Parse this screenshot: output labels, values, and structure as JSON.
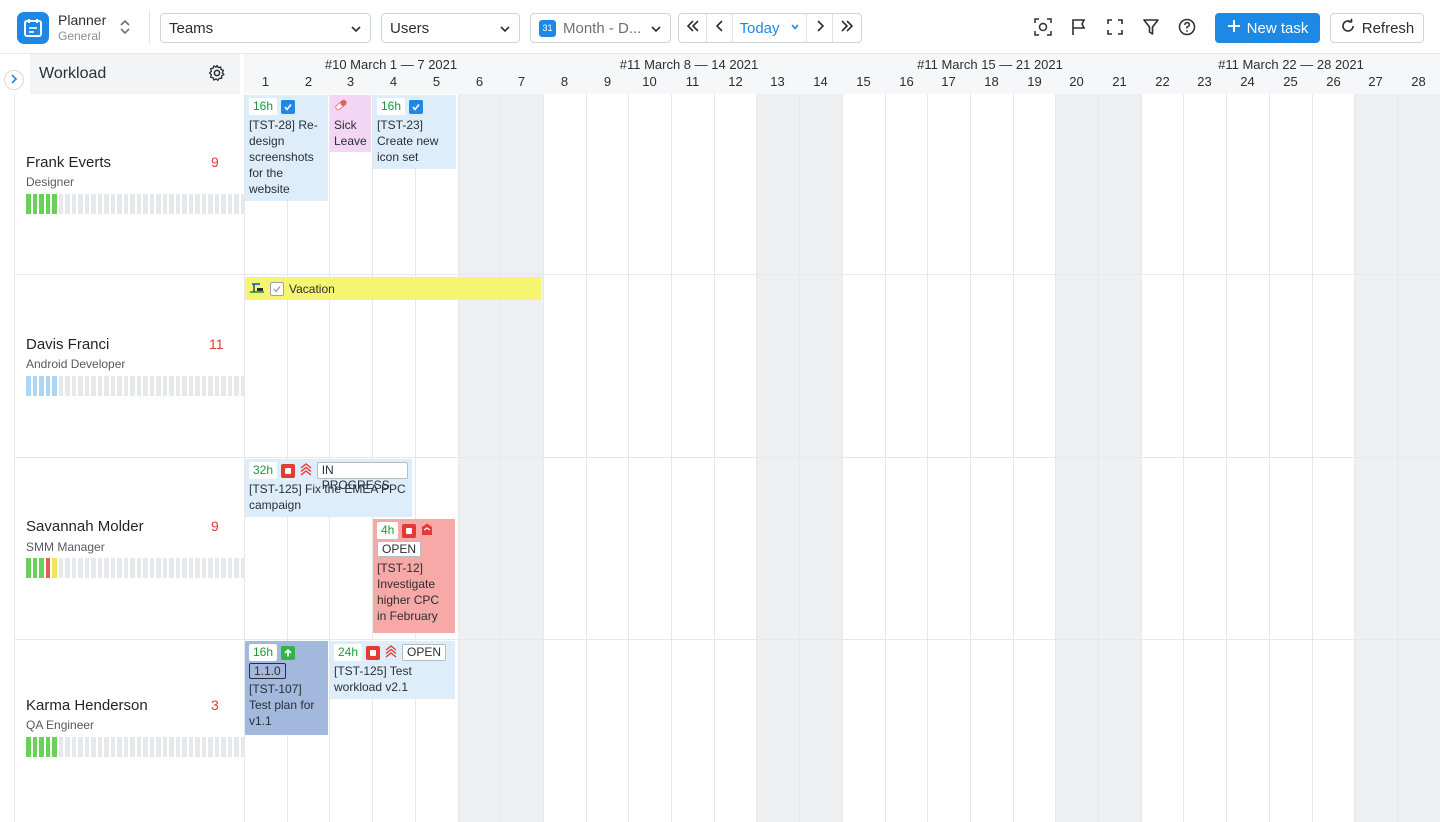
{
  "app": {
    "title": "Planner",
    "subtitle": "General"
  },
  "toolbar": {
    "teams_label": "Teams",
    "users_label": "Users",
    "view_label": "Month - D...",
    "calendar_day": "31",
    "today_label": "Today",
    "new_task_label": "New task",
    "refresh_label": "Refresh"
  },
  "panel": {
    "title": "Workload"
  },
  "weeks": [
    "#10 March 1 — 7 2021",
    "#11 March 8 — 14 2021",
    "#11 March 15 — 21 2021",
    "#11 March 22 — 28 2021"
  ],
  "days": [
    "1",
    "2",
    "3",
    "4",
    "5",
    "6",
    "7",
    "8",
    "9",
    "10",
    "11",
    "12",
    "13",
    "14",
    "15",
    "16",
    "17",
    "18",
    "19",
    "20",
    "21",
    "22",
    "23",
    "24",
    "25",
    "26",
    "27",
    "28"
  ],
  "users": [
    {
      "name": "Frank Everts",
      "role": "Designer",
      "count": "9"
    },
    {
      "name": "Davis Franci",
      "role": "Android Developer",
      "count": "11"
    },
    {
      "name": "Savannah Molder",
      "role": "SMM Manager",
      "count": "9"
    },
    {
      "name": "Karma Henderson",
      "role": "QA Engineer",
      "count": "3"
    }
  ],
  "tasks": {
    "t1": {
      "hours": "16h",
      "text": "[TST-28] Re-design screenshots for the website"
    },
    "t2": {
      "text": "Sick Leave"
    },
    "t3": {
      "hours": "16h",
      "text": "[TST-23] Create new icon set"
    },
    "t4": {
      "text": "Vacation"
    },
    "t5": {
      "hours": "32h",
      "status": "IN PROGRESS",
      "text": "[TST-125] Fix the EMEA PPC campaign"
    },
    "t6": {
      "hours": "4h",
      "status": "OPEN",
      "text": "[TST-12] Investigate higher CPC in February"
    },
    "t7": {
      "hours": "16h",
      "version": "1.1.0",
      "text": "[TST-107] Test plan for v1.1"
    },
    "t8": {
      "hours": "24h",
      "status": "OPEN",
      "text": "[TST-125]  Test workload v2.1"
    }
  },
  "colors": {
    "accent": "#1e88e5",
    "task_blue": "#ddeefa",
    "task_pink": "#f3d6f5",
    "task_yellow": "#f5f571",
    "task_red": "#f6a9a6",
    "task_darkblue": "#a2b8dc",
    "weekend": "#eeeff1",
    "alert": "#e53935"
  }
}
